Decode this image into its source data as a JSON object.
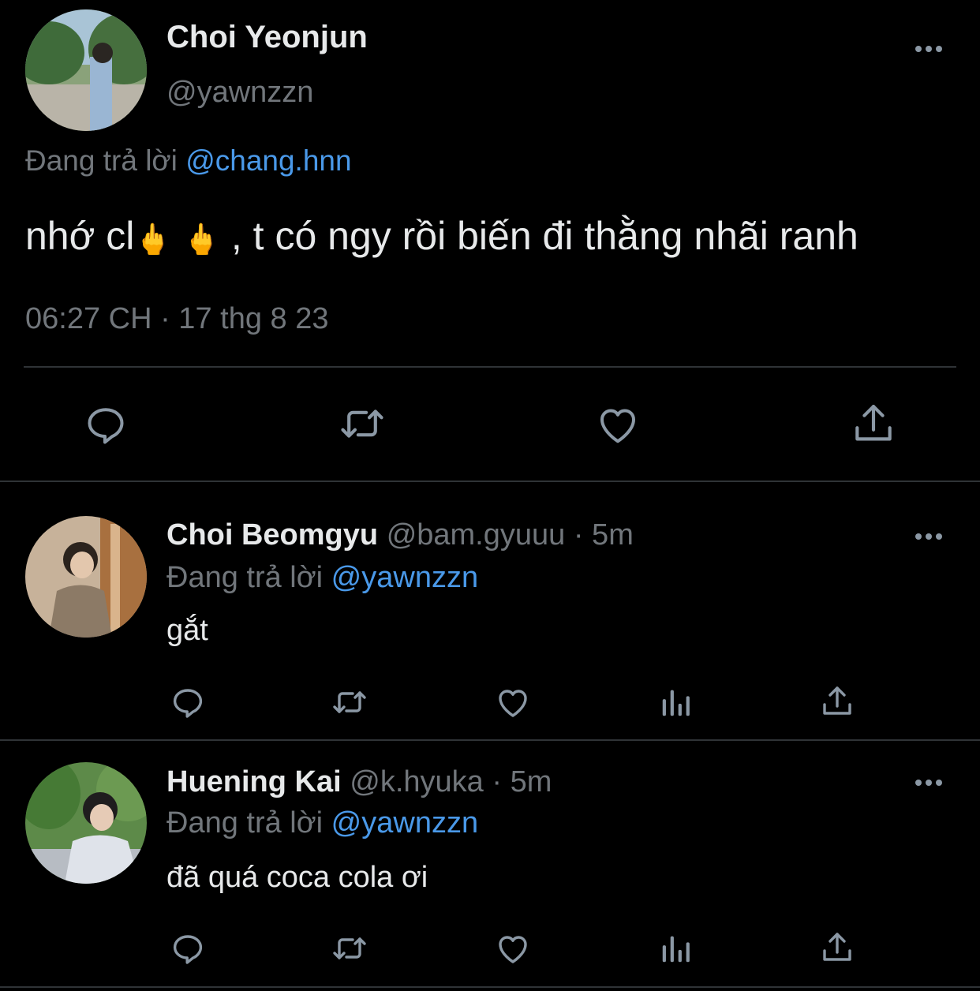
{
  "main_tweet": {
    "display_name": "Choi Yeonjun",
    "handle": "@yawnzzn",
    "replying_prefix": "Đang trả lời",
    "replying_to": "@chang.hnn",
    "text_part1": "nhớ cl",
    "emoji": "🖕",
    "text_part2": ", t có ngy rồi biến đi thằng nhãi ranh",
    "timestamp": "06:27 CH · 17 thg 8 23"
  },
  "replies": [
    {
      "display_name": "Choi Beomgyu",
      "handle": "@bam.gyuuu",
      "time": "· 5m",
      "replying_prefix": "Đang trả lời",
      "replying_to": "@yawnzzn",
      "text": "gắt"
    },
    {
      "display_name": "Huening Kai",
      "handle": "@k.hyuka",
      "time": "· 5m",
      "replying_prefix": "Đang trả lời",
      "replying_to": "@yawnzzn",
      "text": "đã quá coca cola ơi"
    }
  ],
  "icons": [
    "more-icon",
    "reply-icon",
    "retweet-icon",
    "like-icon",
    "share-icon",
    "analytics-icon"
  ],
  "colors": {
    "background": "#000000",
    "text": "#e7e9ea",
    "secondary": "#71767b",
    "link": "#4a99e9",
    "divider": "#2f3336"
  }
}
